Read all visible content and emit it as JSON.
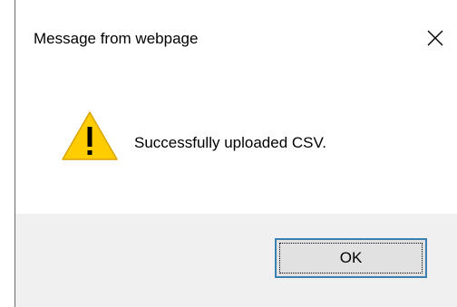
{
  "dialog": {
    "title": "Message from webpage",
    "message": "Successfully uploaded CSV.",
    "icon": "warning-icon",
    "ok_label": "OK",
    "close_glyph": "✕"
  },
  "colors": {
    "warning_fill": "#ffcc00",
    "footer_background": "#f0f0f0",
    "button_border": "#3c7fb1",
    "button_background": "#e1e1e1"
  }
}
